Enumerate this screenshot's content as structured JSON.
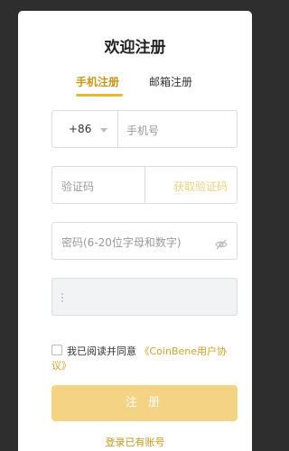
{
  "page": {
    "title": "欢迎注册"
  },
  "tabs": [
    {
      "label": "手机注册",
      "active": true
    },
    {
      "label": "邮箱注册",
      "active": false
    }
  ],
  "phone": {
    "country_code": "+86",
    "placeholder": "手机号"
  },
  "verify": {
    "placeholder": "验证码",
    "get_code_label": "获取验证码"
  },
  "password": {
    "placeholder": "密码(6-20位字母和数字)"
  },
  "captcha": {
    "placeholder": ""
  },
  "agreement": {
    "text": "我已阅读并同意",
    "link": "《CoinBene用户协议》"
  },
  "register_button": {
    "label": "注 册"
  },
  "login_link": {
    "label": "登录已有账号"
  },
  "colors": {
    "accent": "#e9b63b",
    "button": "#f4d385",
    "background": "#2e2e2e"
  }
}
